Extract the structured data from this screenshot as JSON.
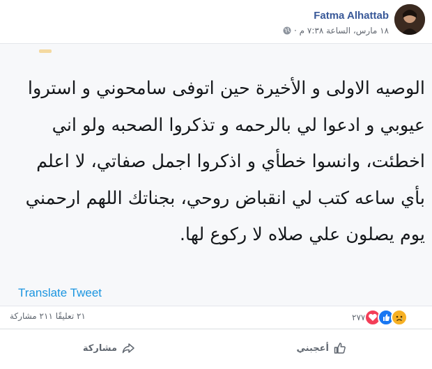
{
  "header": {
    "author": "Fatma Alhattab",
    "timestamp": "١٨ مارس، الساعة ٧:٣٨ م ·",
    "privacy_icon": "globe-icon"
  },
  "tweet": {
    "text": "الوصيه الاولى و الأخيرة حين اتوفى سامحوني و استروا عيوبي و ادعوا لي بالرحمه و تذكروا الصحبه ولو اني اخطئت، وانسوا خطأي و اذكروا اجمل صفاتي، لا اعلم بأي ساعه كتب لي انقباض روحي، بجناتك اللهم ارحمني يوم يصلون علي صلاه لا ركوع لها.",
    "translate_label": "Translate Tweet"
  },
  "stats": {
    "reactions_count": "٢٧٧",
    "comments_shares": "٢١ تعليقًا  ٢١١ مشاركة",
    "reaction_icons": [
      "sad-reaction-icon",
      "like-reaction-icon",
      "love-reaction-icon"
    ]
  },
  "actions": {
    "like_label": "أعجبني",
    "share_label": "مشاركة"
  },
  "colors": {
    "author_link": "#385898",
    "tweet_bg": "#f7f8fa",
    "translate_link": "#1b95e0",
    "like_blue": "#1877f2",
    "love_red": "#f33e58",
    "sad_yellow": "#f7b125"
  }
}
